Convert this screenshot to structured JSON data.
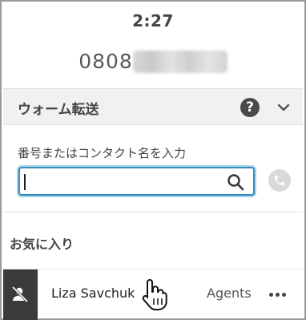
{
  "call": {
    "timer": "2:27",
    "phone_visible": "0808"
  },
  "transfer": {
    "title": "ウォーム転送",
    "help_icon": "question-circle-icon",
    "chevron_icon": "chevron-down-icon"
  },
  "search": {
    "label": "番号またはコンタクト名を入力",
    "value": "",
    "placeholder": "",
    "icon": "search-icon",
    "call_icon": "phone-icon"
  },
  "favorites": {
    "heading": "お気に入り",
    "items": [
      {
        "name": "Liza Savchuk",
        "group": "Agents",
        "avatar_icon": "user-blocked-icon",
        "more_icon": "more-horizontal-icon"
      }
    ]
  },
  "colors": {
    "accent": "#2f8fc0",
    "section_bg": "#f1f1f1",
    "avatar_bg": "#3b3b3b"
  }
}
